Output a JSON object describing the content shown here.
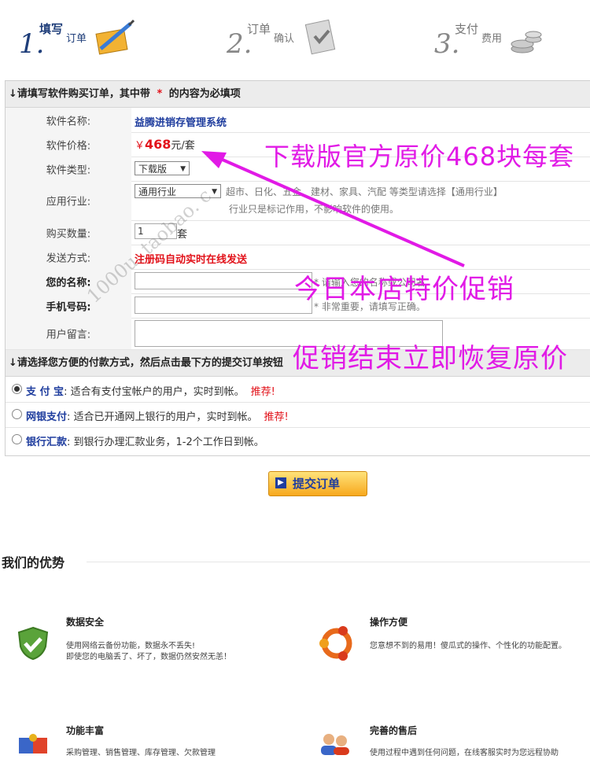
{
  "steps": [
    {
      "num": "1.",
      "title_a": "填写",
      "title_b": "订单"
    },
    {
      "num": "2.",
      "title_a": "订单",
      "title_b": "确认"
    },
    {
      "num": "3.",
      "title_a": "支付",
      "title_b": "费用"
    }
  ],
  "order_section": {
    "header_prefix": "↓请填写软件购买订单，其中带",
    "header_star": "*",
    "header_suffix": "的内容为必填项"
  },
  "fields": {
    "software_name": {
      "label": "软件名称:",
      "value": "益腾进销存管理系统"
    },
    "software_price": {
      "label": "软件价格:",
      "currency": "￥",
      "amount": "468",
      "unit": "元/套"
    },
    "software_type": {
      "label": "软件类型:",
      "selected": "下载版"
    },
    "industry": {
      "label": "应用行业:",
      "selected": "通用行业",
      "hint_line1": "超市、日化、五金、建材、家具、汽配 等类型请选择【通用行业】",
      "hint_line2": "行业只是标记作用，不影响软件的使用。"
    },
    "quantity": {
      "label": "购买数量:",
      "value": "1",
      "unit": "套"
    },
    "delivery": {
      "label": "发送方式:",
      "value": "注册码自动实时在线发送"
    },
    "your_name": {
      "label": "您的名称:",
      "hint": "* 请输入您的名称或公司名"
    },
    "phone": {
      "label": "手机号码:",
      "hint": "* 非常重要，请填写正确。"
    },
    "message": {
      "label": "用户留言:"
    }
  },
  "payment_section": {
    "header": "↓请选择您方便的付款方式，然后点击最下方的提交订单按钮",
    "options": [
      {
        "name": "支 付 宝",
        "desc": ": 适合有支付宝帐户的用户，实时到帐。",
        "badge": "推荐!",
        "selected": true
      },
      {
        "name": "网银支付",
        "desc": ": 适合已开通网上银行的用户，实时到帐。",
        "badge": "推荐!",
        "selected": false
      },
      {
        "name": "银行汇款",
        "desc": ": 到银行办理汇款业务，1-2个工作日到帐。",
        "badge": "",
        "selected": false
      }
    ]
  },
  "submit_label": "提交订单",
  "advantages": {
    "title": "我们的优势",
    "items": [
      {
        "title": "数据安全",
        "line1": "使用网络云备份功能，数据永不丢失!",
        "line2": "即使您的电脑丢了、坏了，数据仍然安然无恙！"
      },
      {
        "title": "操作方便",
        "line1": "您意想不到的易用！傻瓜式的操作、个性化的功能配置。",
        "line2": ""
      },
      {
        "title": "功能丰富",
        "line1": "采购管理、销售管理、库存管理、欠款管理",
        "line2": ""
      },
      {
        "title": "完善的售后",
        "line1": "使用过程中遇到任何问题，在线客服实时为您远程协助",
        "line2": ""
      }
    ]
  },
  "promo": {
    "line1": "下载版官方原价468块每套",
    "line2": "今日本店特价促销",
    "line3": "促销结束立即恢复原价"
  },
  "watermark": "1000u. taobao. c",
  "colors": {
    "promo": "#e11ae6",
    "price": "#e2121a",
    "link_blue": "#1f3d9e",
    "header_bg": "#ececec"
  }
}
